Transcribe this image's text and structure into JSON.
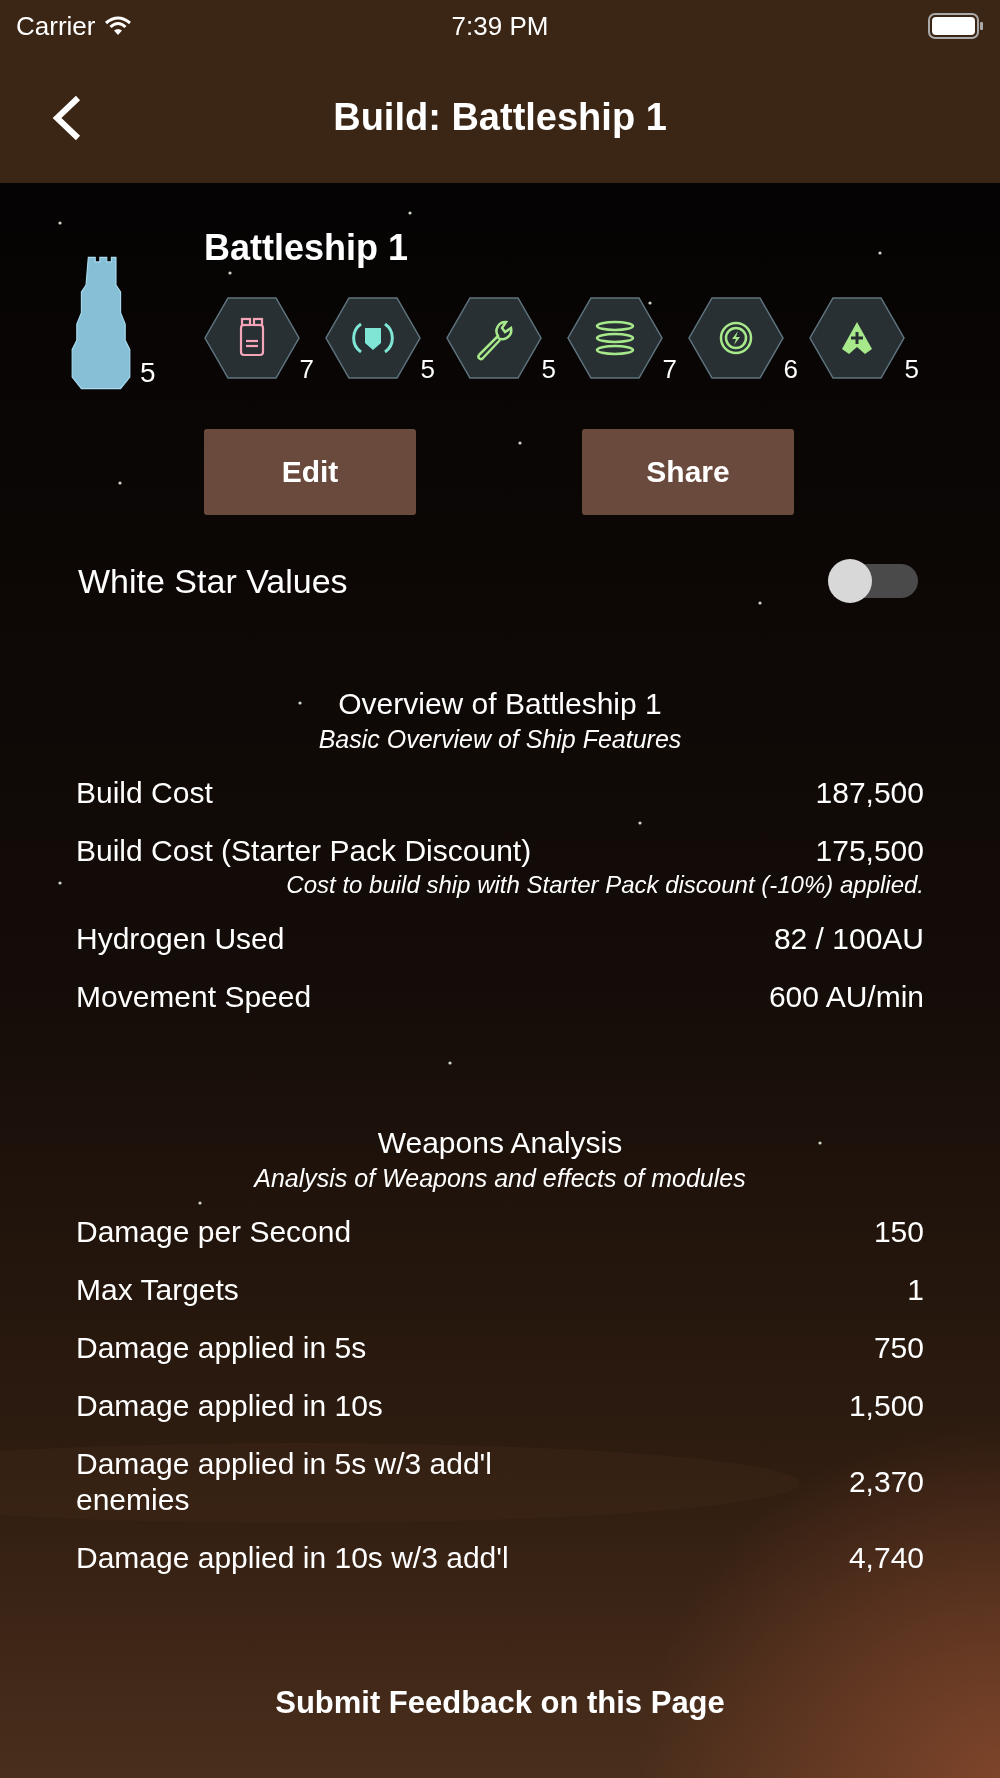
{
  "status_bar": {
    "carrier": "Carrier",
    "time": "7:39 PM"
  },
  "nav": {
    "title": "Build: Battleship 1"
  },
  "ship": {
    "name": "Battleship 1",
    "count": "5",
    "modules": [
      {
        "kind": "weapon",
        "color": "#f4a6b8",
        "count": "7"
      },
      {
        "kind": "shield",
        "color": "#7fe6d6",
        "count": "5"
      },
      {
        "kind": "repair",
        "color": "#a6e88a",
        "count": "5"
      },
      {
        "kind": "rings",
        "color": "#a6e88a",
        "count": "7"
      },
      {
        "kind": "energy",
        "color": "#a6e88a",
        "count": "6"
      },
      {
        "kind": "boost",
        "color": "#a6e88a",
        "count": "5"
      }
    ]
  },
  "buttons": [
    "Edit",
    "Share"
  ],
  "white_star": {
    "label": "White Star Values",
    "on": false
  },
  "sections": [
    {
      "title": "Overview of Battleship 1",
      "subtitle": "Basic Overview of Ship Features",
      "rows": [
        {
          "label": "Build Cost",
          "value": "187,500"
        },
        {
          "label": "Build Cost (Starter Pack Discount)",
          "value": "175,500",
          "note": "Cost to build ship with Starter Pack discount (-10%) applied."
        },
        {
          "label": "Hydrogen Used",
          "value": "82 / 100AU"
        },
        {
          "label": "Movement Speed",
          "value": "600 AU/min"
        }
      ]
    },
    {
      "title": "Weapons Analysis",
      "subtitle": "Analysis of Weapons and effects of modules",
      "rows": [
        {
          "label": "Damage per Second",
          "value": "150"
        },
        {
          "label": "Max Targets",
          "value": "1"
        },
        {
          "label": "Damage applied in 5s",
          "value": "750"
        },
        {
          "label": "Damage applied in 10s",
          "value": "1,500"
        },
        {
          "label": "Damage applied in 5s w/3 add'l enemies",
          "value": "2,370"
        },
        {
          "label": "Damage applied in 10s w/3 add'l",
          "value": "4,740"
        }
      ]
    }
  ],
  "footer": {
    "link": "Submit Feedback on this Page"
  }
}
